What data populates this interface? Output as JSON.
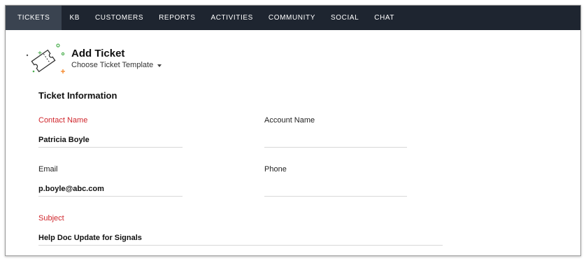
{
  "nav": {
    "items": [
      "TICKETS",
      "KB",
      "CUSTOMERS",
      "REPORTS",
      "ACTIVITIES",
      "COMMUNITY",
      "SOCIAL",
      "CHAT"
    ],
    "active": "TICKETS",
    "background": "#1e2530",
    "active_background": "#3a4350"
  },
  "header": {
    "title": "Add Ticket",
    "template_label": "Choose Ticket Template",
    "illustration_icon": "ticket-icon"
  },
  "form": {
    "section_title": "Ticket Information",
    "required_color": "#d0262c",
    "contact_name": {
      "label": "Contact Name",
      "value": "Patricia Boyle"
    },
    "account_name": {
      "label": "Account Name",
      "value": ""
    },
    "email": {
      "label": "Email",
      "value": "p.boyle@abc.com"
    },
    "phone": {
      "label": "Phone",
      "value": ""
    },
    "subject": {
      "label": "Subject",
      "value": "Help Doc Update for Signals"
    }
  }
}
